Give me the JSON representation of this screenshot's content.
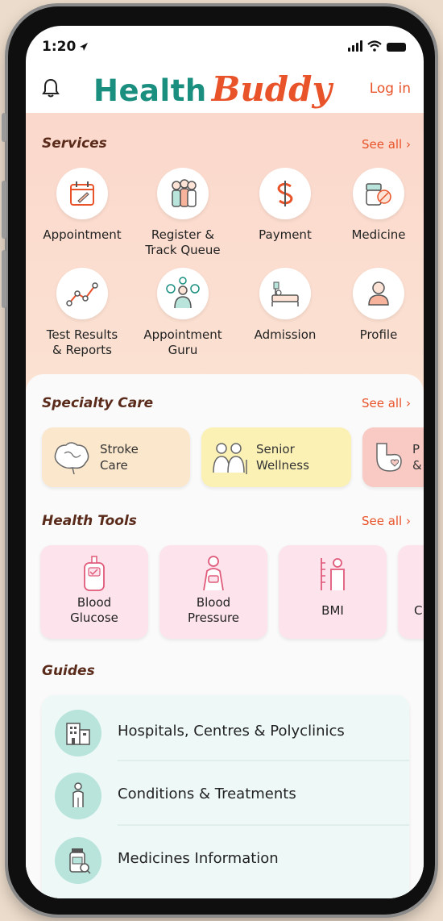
{
  "status": {
    "time": "1:20"
  },
  "header": {
    "logo_part1": "Health",
    "logo_part2": "Buddy",
    "login": "Log in"
  },
  "services": {
    "title": "Services",
    "see_all": "See all ›",
    "items": [
      {
        "label": "Appointment",
        "icon": "calendar-icon"
      },
      {
        "label": "Register &\nTrack Queue",
        "icon": "queue-people-icon"
      },
      {
        "label": "Payment",
        "icon": "dollar-icon"
      },
      {
        "label": "Medicine",
        "icon": "pill-bottle-icon"
      },
      {
        "label": "Test Results\n& Reports",
        "icon": "chart-line-icon"
      },
      {
        "label": "Appointment\nGuru",
        "icon": "guru-icon"
      },
      {
        "label": "Admission",
        "icon": "hospital-bed-icon"
      },
      {
        "label": "Profile",
        "icon": "person-icon"
      }
    ]
  },
  "specialty": {
    "title": "Specialty Care",
    "see_all": "See all ›",
    "items": [
      {
        "label": "Stroke\nCare",
        "icon": "brain-icon",
        "color": "#fbe7cc"
      },
      {
        "label": "Senior\nWellness",
        "icon": "seniors-icon",
        "color": "#fbf1b5"
      },
      {
        "label": "P\n&",
        "icon": "pregnancy-icon",
        "color": "#f9c9c4"
      }
    ]
  },
  "tools": {
    "title": "Health Tools",
    "see_all": "See all ›",
    "items": [
      {
        "label": "Blood\nGlucose",
        "icon": "glucose-meter-icon"
      },
      {
        "label": "Blood\nPressure",
        "icon": "blood-pressure-icon"
      },
      {
        "label": "BMI",
        "icon": "bmi-icon"
      },
      {
        "label": "C",
        "icon": "tool-icon"
      }
    ]
  },
  "guides": {
    "title": "Guides",
    "items": [
      {
        "label": "Hospitals, Centres & Polyclinics",
        "icon": "hospital-building-icon"
      },
      {
        "label": "Conditions & Treatments",
        "icon": "person-body-icon"
      },
      {
        "label": "Medicines Information",
        "icon": "medicine-bottle-icon"
      }
    ]
  },
  "colors": {
    "brand_teal": "#1a8f80",
    "brand_orange": "#e8532a",
    "section_title": "#5a2b1b"
  }
}
